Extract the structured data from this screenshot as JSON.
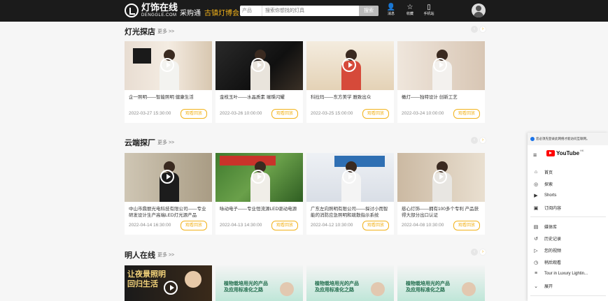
{
  "header": {
    "logo_cn": "灯饰在线",
    "logo_en": "DENGGLE.COM",
    "nav": [
      "采购通",
      "古镇灯博会"
    ],
    "search_select": "产品",
    "search_placeholder": "搜索你想找的灯具",
    "search_button": "搜索",
    "icons": [
      {
        "name": "user-icon",
        "label": "消息"
      },
      {
        "name": "star-icon",
        "label": "收藏"
      },
      {
        "name": "phone-icon",
        "label": "手机站"
      }
    ]
  },
  "sections": [
    {
      "title": "灯光探店",
      "more": "更多 >>",
      "cards": [
        {
          "title": "企一照明——智能照明 健康生活",
          "date": "2022-03-27 15:30:00",
          "button": "观看回放"
        },
        {
          "title": "金枝玉叶——水晶质素 璀璨闪耀",
          "date": "2022-03-26 10:00:00",
          "button": "观看回放"
        },
        {
          "title": "科拉玛——东方美学 雅致出众",
          "date": "2022-03-25 15:00:00",
          "button": "观看回放"
        },
        {
          "title": "橄灯——独特设计 创新工艺",
          "date": "2022-03-24 10:00:00",
          "button": "观看回放"
        }
      ]
    },
    {
      "title": "云端探厂",
      "more": "更多 >>",
      "cards": [
        {
          "title": "中山市鼎丽光电科技有限公司——专业研发设计生产高端LED灯光源产品",
          "date": "2022-04-14 16:30:00",
          "button": "观看回放"
        },
        {
          "title": "咏动电子——专业恒流源LED驱动电源",
          "date": "2022-04-13 14:30:00",
          "button": "观看回放"
        },
        {
          "title": "广东左向照明有限公司——探讨小而智能的消防应急照明和疏散指示系统",
          "date": "2022-04-12 10:30:00",
          "button": "观看回放"
        },
        {
          "title": "慈心灯饰——拥有100多个专利 产品获得大部分出口认证",
          "date": "2022-04-08 10:30:00",
          "button": "观看回放"
        }
      ]
    },
    {
      "title": "明人在线",
      "more": "更多 >>",
      "ads": [
        {
          "text": "让夜景照明 回归生活"
        },
        {
          "text": "植物栽培用光的产品 及应用标准化之路"
        },
        {
          "text": "植物栽培用光的产品 及应用标准化之路"
        },
        {
          "text": "植物栽培用光的产品 及应用标准化之路"
        }
      ]
    }
  ],
  "youtube": {
    "notice": "您必须先登录此网络才能访问互联网。",
    "logo": "YouTube",
    "region": "HK",
    "items": [
      {
        "icon": "home-icon",
        "glyph": "⌂",
        "label": "首页"
      },
      {
        "icon": "explore-icon",
        "glyph": "◎",
        "label": "探索"
      },
      {
        "icon": "shorts-icon",
        "glyph": "▶",
        "label": "Shorts"
      },
      {
        "icon": "subscriptions-icon",
        "glyph": "▣",
        "label": "订阅内容"
      },
      {
        "icon": "library-icon",
        "glyph": "▤",
        "label": "媒体库"
      },
      {
        "icon": "history-icon",
        "glyph": "↺",
        "label": "历史记录"
      },
      {
        "icon": "your-videos-icon",
        "glyph": "▷",
        "label": "您的视频"
      },
      {
        "icon": "watch-later-icon",
        "glyph": "◷",
        "label": "稍后观看"
      },
      {
        "icon": "playlist-icon",
        "glyph": "≡",
        "label": "Tour in Luxury Lightin..."
      },
      {
        "icon": "chevron-down-icon",
        "glyph": "⌄",
        "label": "展开"
      }
    ]
  },
  "colors": {
    "accent": "#f2b21a",
    "topbar": "#1b1b1b"
  }
}
